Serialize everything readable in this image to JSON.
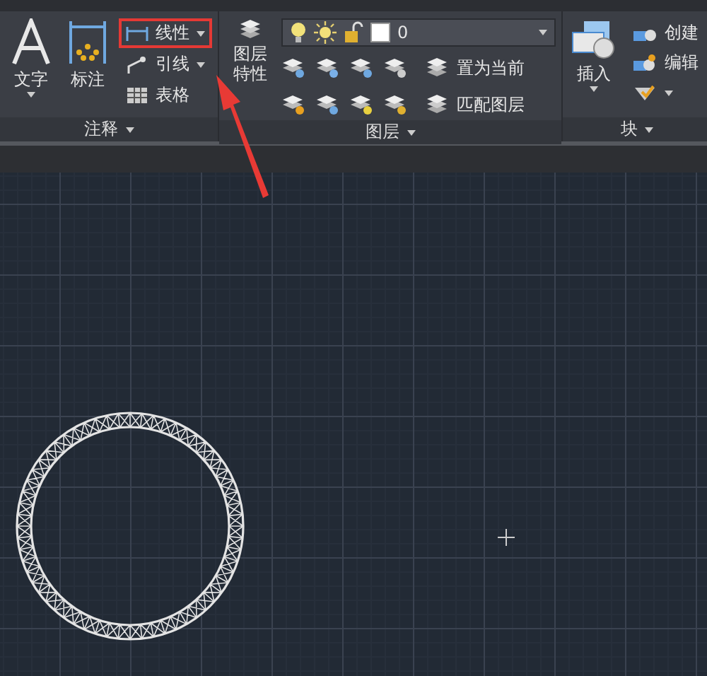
{
  "ribbon": {
    "panels": [
      {
        "kind": "annotation",
        "title": "注释",
        "large_buttons": [
          {
            "label": "文字",
            "has_menu": true
          },
          {
            "label": "标注",
            "has_menu": false
          }
        ],
        "small_buttons": [
          {
            "label": "线性",
            "has_menu": true,
            "highlighted": true
          },
          {
            "label": "引线",
            "has_menu": true,
            "highlighted": false
          },
          {
            "label": "表格",
            "has_menu": false,
            "highlighted": false
          }
        ]
      },
      {
        "kind": "layers",
        "title": "图层",
        "large_buttons": [
          {
            "label": "图层特性",
            "has_menu": false
          }
        ],
        "layer_dropdown": {
          "value": "0"
        },
        "small_buttons": [
          {
            "label": "置为当前"
          },
          {
            "label": "匹配图层"
          }
        ]
      },
      {
        "kind": "block",
        "title": "块",
        "large_buttons": [
          {
            "label": "插入",
            "has_menu": true
          }
        ],
        "small_buttons": [
          {
            "label": "创建",
            "has_menu": false
          },
          {
            "label": "编辑",
            "has_menu": false
          },
          {
            "has_menu": true
          }
        ]
      }
    ]
  }
}
